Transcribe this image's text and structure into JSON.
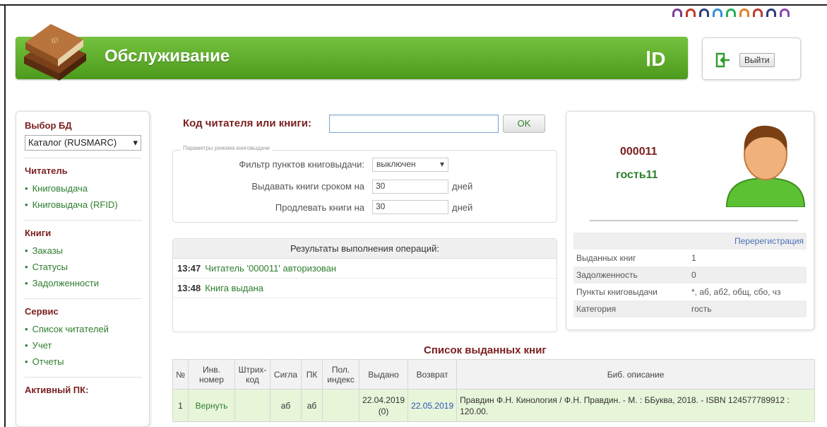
{
  "header": {
    "title": "Обслуживание",
    "logo_text": "ⅠD"
  },
  "logout": {
    "label": "Выйти"
  },
  "arch_colors": [
    "#7a3b9a",
    "#c0392b",
    "#2c3e7a",
    "#2f8fd8",
    "#27ae60",
    "#e67e22",
    "#c0392b",
    "#2c3e7a",
    "#8e44ad"
  ],
  "sidebar": {
    "db_heading": "Выбор БД",
    "db_selected": "Каталог (RUSMARC)",
    "sections": [
      {
        "heading": "Читатель",
        "items": [
          "Книговыдача",
          "Книговыдача (RFID)"
        ]
      },
      {
        "heading": "Книги",
        "items": [
          "Заказы",
          "Статусы",
          "Задолженности"
        ]
      },
      {
        "heading": "Сервис",
        "items": [
          "Список читателей",
          "Учет",
          "Отчеты"
        ]
      },
      {
        "heading": "Активный ПК:",
        "items": []
      }
    ]
  },
  "search": {
    "label": "Код читателя или книги:",
    "value": "",
    "ok_label": "OK"
  },
  "params": {
    "legend": "Параметры режима книговыдачи",
    "filter_label": "Фильтр пунктов книговыдачи:",
    "filter_value": "выключен",
    "issue_label": "Выдавать книги сроком на",
    "issue_value": "30",
    "extend_label": "Продлевать книги на",
    "extend_value": "30",
    "unit": "дней"
  },
  "results": {
    "heading": "Результаты выполнения операций:",
    "rows": [
      {
        "time": "13:47",
        "message": "Читатель '000011' авторизован"
      },
      {
        "time": "13:48",
        "message": "Книга выдана"
      }
    ]
  },
  "reader": {
    "id": "000011",
    "name": "гость11",
    "reregister_label": "Перерегистрация",
    "info": [
      {
        "key": "Выданных книг",
        "value": "1"
      },
      {
        "key": "Задолженность",
        "value": "0"
      },
      {
        "key": "Пункты книговыдачи",
        "value": "*, аб, аб2, общ, сбо, чз"
      },
      {
        "key": "Категория",
        "value": "гость"
      }
    ]
  },
  "issued": {
    "title": "Список выданных книг",
    "columns": [
      "№",
      "Инв. номер",
      "Штрих-код",
      "Сигла",
      "ПК",
      "Пол. индекс",
      "Выдано",
      "Возврат",
      "Биб. описание"
    ],
    "rows": [
      {
        "num": "1",
        "inv": "Вернуть",
        "barcode": "",
        "sigla": "аб",
        "pk": "аб",
        "index": "",
        "issued": "22.04.2019 (0)",
        "return": "22.05.2019",
        "description": "Правдин Ф.Н. Кинология / Ф.Н. Правдин. - М. : ББуква, 2018. - ISBN 124577789912 : 120.00."
      }
    ]
  }
}
